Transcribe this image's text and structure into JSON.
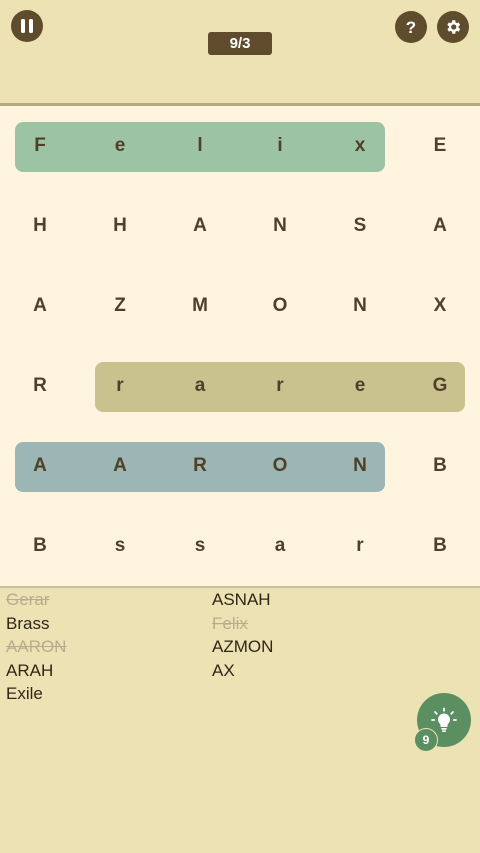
{
  "header": {
    "counter": "9/3",
    "pause_icon": "pause-icon",
    "help_icon": "help-icon",
    "settings_icon": "gear-icon"
  },
  "grid": [
    [
      "F",
      "e",
      "l",
      "i",
      "x",
      "E"
    ],
    [
      "H",
      "H",
      "A",
      "N",
      "S",
      "A"
    ],
    [
      "A",
      "Z",
      "M",
      "O",
      "N",
      "X"
    ],
    [
      "R",
      "r",
      "a",
      "r",
      "e",
      "G"
    ],
    [
      "A",
      "A",
      "R",
      "O",
      "N",
      "B"
    ],
    [
      "B",
      "s",
      "s",
      "a",
      "r",
      "B"
    ]
  ],
  "word_list": {
    "column1": [
      {
        "text": "Gerar",
        "found": true
      },
      {
        "text": "Brass",
        "found": false
      },
      {
        "text": "AARON",
        "found": true
      },
      {
        "text": "ARAH",
        "found": false
      },
      {
        "text": "Exile",
        "found": false
      }
    ],
    "column2": [
      {
        "text": "ASNAH",
        "found": false
      },
      {
        "text": "Felix",
        "found": true
      },
      {
        "text": "AZMON",
        "found": false
      },
      {
        "text": "AX",
        "found": false
      }
    ]
  },
  "hint": {
    "icon": "lightbulb-icon",
    "count": "9"
  },
  "colors": {
    "accent": "#5e4c2c",
    "highlight_green": "#9cc4a4",
    "highlight_olive": "#c9c28f",
    "highlight_blue": "#9cb5b5",
    "hint_green": "#5b8f62"
  }
}
